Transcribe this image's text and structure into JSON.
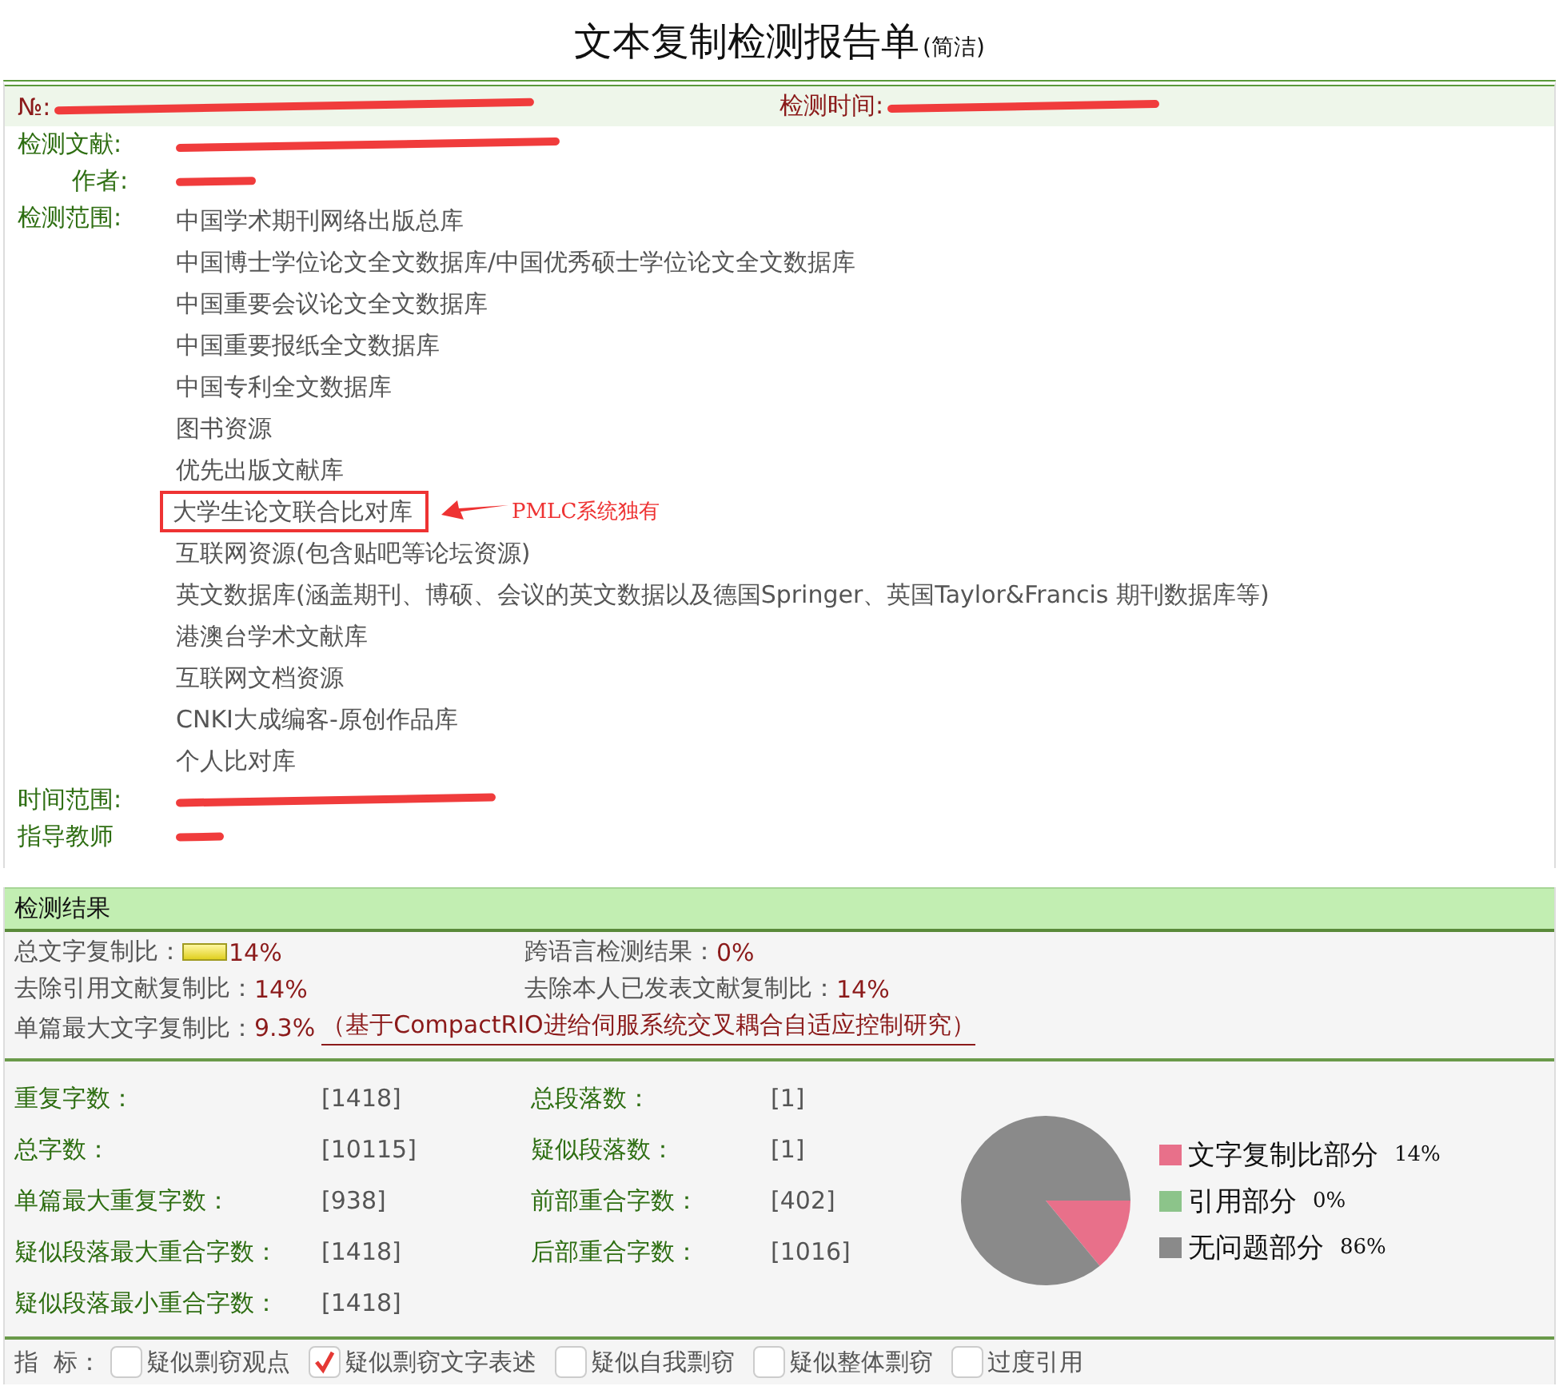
{
  "title": "文本复制检测报告单",
  "title_note": "(简洁)",
  "report": {
    "number_label": "№:",
    "time_label": "检测时间:",
    "fields": [
      {
        "label": "检测文献:",
        "kind": "redacted"
      },
      {
        "label": "作者:",
        "kind": "redacted"
      },
      {
        "label": "检测范围:",
        "kind": "list",
        "databases": [
          {
            "name": "中国学术期刊网络出版总库",
            "highlighted": false
          },
          {
            "name": "中国博士学位论文全文数据库/中国优秀硕士学位论文全文数据库",
            "highlighted": false
          },
          {
            "name": "中国重要会议论文全文数据库",
            "highlighted": false
          },
          {
            "name": "中国重要报纸全文数据库",
            "highlighted": false
          },
          {
            "name": "中国专利全文数据库",
            "highlighted": false
          },
          {
            "name": "图书资源",
            "highlighted": false
          },
          {
            "name": "优先出版文献库",
            "highlighted": false
          },
          {
            "name": "大学生论文联合比对库",
            "highlighted": true,
            "annotation": "PMLC系统独有"
          },
          {
            "name": "互联网资源(包含贴吧等论坛资源)",
            "highlighted": false
          },
          {
            "name": "英文数据库(涵盖期刊、博硕、会议的英文数据以及德国Springer、英国Taylor&Francis 期刊数据库等)",
            "highlighted": false
          },
          {
            "name": "港澳台学术文献库",
            "highlighted": false
          },
          {
            "name": "互联网文档资源",
            "highlighted": false
          },
          {
            "name": "CNKI大成编客-原创作品库",
            "highlighted": false
          },
          {
            "name": "个人比对库",
            "highlighted": false
          }
        ]
      },
      {
        "label": "时间范围:",
        "kind": "redacted"
      },
      {
        "label": "指导教师",
        "kind": "redacted"
      }
    ]
  },
  "results": {
    "title": "检测结果",
    "ratios": [
      {
        "label": "总文字复制比：",
        "value": "14%",
        "kind": "meter"
      },
      {
        "label": "跨语言检测结果：",
        "value": "0%",
        "kind": "plain"
      },
      {
        "label": "去除引用文献复制比：",
        "value": "14%",
        "kind": "plain"
      },
      {
        "label": "去除本人已发表文献复制比：",
        "value": "14%",
        "kind": "plain"
      }
    ],
    "max_ratio": {
      "label": "单篇最大文字复制比：",
      "value": "9.3%",
      "link": "（基于CompactRIO进给伺服系统交叉耦合自适应控制研究）"
    },
    "counts": [
      {
        "label": "重复字数：",
        "value": "[1418]"
      },
      {
        "label": "总段落数：",
        "value": "[1]"
      },
      {
        "label": "总字数：",
        "value": "[10115]"
      },
      {
        "label": "疑似段落数：",
        "value": "[1]"
      },
      {
        "label": "单篇最大重复字数：",
        "value": "[938]"
      },
      {
        "label": "前部重合字数：",
        "value": "[402]"
      },
      {
        "label": "疑似段落最大重合字数：",
        "value": "[1418]"
      },
      {
        "label": "后部重合字数：",
        "value": "[1016]"
      },
      {
        "label": "疑似段落最小重合字数：",
        "value": "[1418]"
      }
    ],
    "chart_data": {
      "type": "pie",
      "categories": [
        "文字复制比部分",
        "引用部分",
        "无问题部分"
      ],
      "series": [
        {
          "values": [
            14,
            0,
            86
          ]
        }
      ],
      "colors": [
        "#e8708a",
        "#8cc48a",
        "#8a8a8a"
      ],
      "value_labels": [
        "14%",
        "0%",
        "86%"
      ],
      "legend": "right"
    },
    "indicators": {
      "label": "指  标：",
      "items": [
        {
          "label": "疑似剽窃观点",
          "checked": false
        },
        {
          "label": "疑似剽窃文字表述",
          "checked": true
        },
        {
          "label": "疑似自我剽窃",
          "checked": false
        },
        {
          "label": "疑似整体剽窃",
          "checked": false
        },
        {
          "label": "过度引用",
          "checked": false
        }
      ]
    }
  }
}
